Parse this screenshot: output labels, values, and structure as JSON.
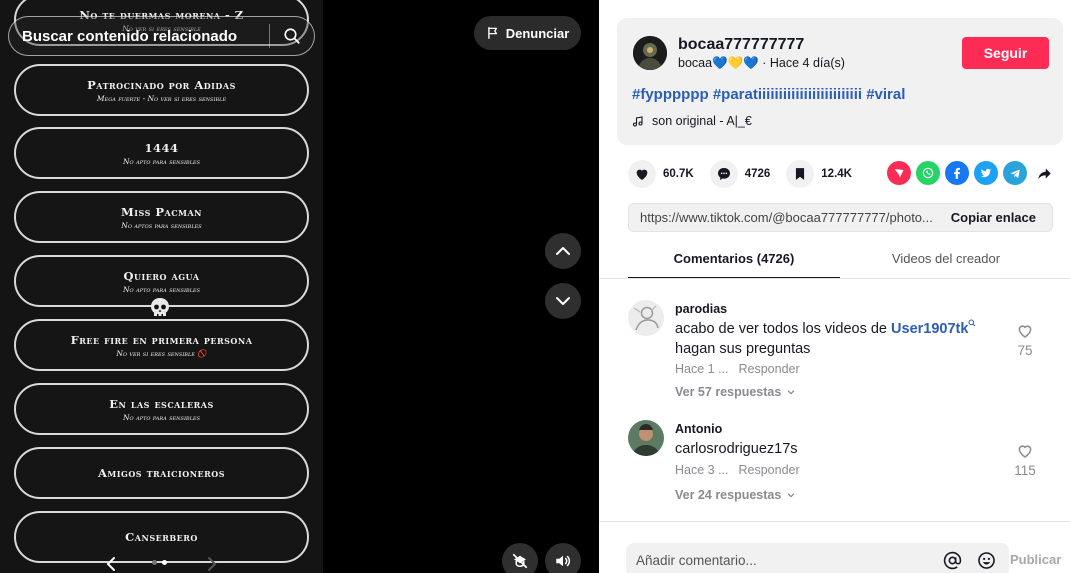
{
  "video": {
    "search_placeholder": "Buscar contenido relacionado",
    "report_label": "Denunciar",
    "pills": [
      {
        "title": "No te duermas morena - Z",
        "sub": "No ver si eres sensible"
      },
      {
        "title": "Patrocinado por Adidas",
        "sub": "Mega fuerte - No ver si eres sensible"
      },
      {
        "title": "1444",
        "sub": "No apto para sensibles"
      },
      {
        "title": "Miss Pacman",
        "sub": "No aptos para sensibles"
      },
      {
        "title": "Quiero agua",
        "sub": "No apto para sensibles"
      },
      {
        "title": "Free fire en primera persona",
        "sub": "No ver si eres sensible 🚫"
      },
      {
        "title": "En las escaleras",
        "sub": "No apto para sensibles"
      },
      {
        "title": "Amigos traicioneros",
        "sub": ""
      },
      {
        "title": "Canserbero",
        "sub": ""
      }
    ]
  },
  "post": {
    "username": "bocaa777777777",
    "nickname": "bocaa💙💛💙",
    "time": "· Hace 4 día(s)",
    "follow_label": "Seguir",
    "hashtags": "#fypppppp #paratiiiiiiiiiiiiiiiiiiiiiiiii #viral",
    "sound": "son original - A|_€"
  },
  "actions": {
    "likes": "60.7K",
    "comments": "4726",
    "saves": "12.4K"
  },
  "share_colors": {
    "pin": "#fe2c55",
    "whatsapp": "#25d366",
    "facebook": "#1877f2",
    "twitter": "#1da1f2",
    "telegram": "#2aa3dd"
  },
  "link": {
    "url": "https://www.tiktok.com/@bocaa777777777/photo...",
    "copy_label": "Copiar enlace"
  },
  "tabs": {
    "comments": "Comentarios (4726)",
    "creator_videos": "Videos del creador"
  },
  "comments": [
    {
      "user": "parodias",
      "text_before": "acabo de ver todos los videos de ",
      "mention": "User1907tk",
      "text_after": "hagan sus preguntas",
      "time": "Hace 1 ...",
      "reply": "Responder",
      "replies": "Ver 57 respuestas",
      "likes": "75"
    },
    {
      "user": "Antonio",
      "text_before": "carlosrodriguez17s",
      "mention": "",
      "text_after": "",
      "time": "Hace 3 ...",
      "reply": "Responder",
      "replies": "Ver 24 respuestas",
      "likes": "115"
    }
  ],
  "comment_input": {
    "placeholder": "Añadir comentario...",
    "publish_label": "Publicar"
  }
}
